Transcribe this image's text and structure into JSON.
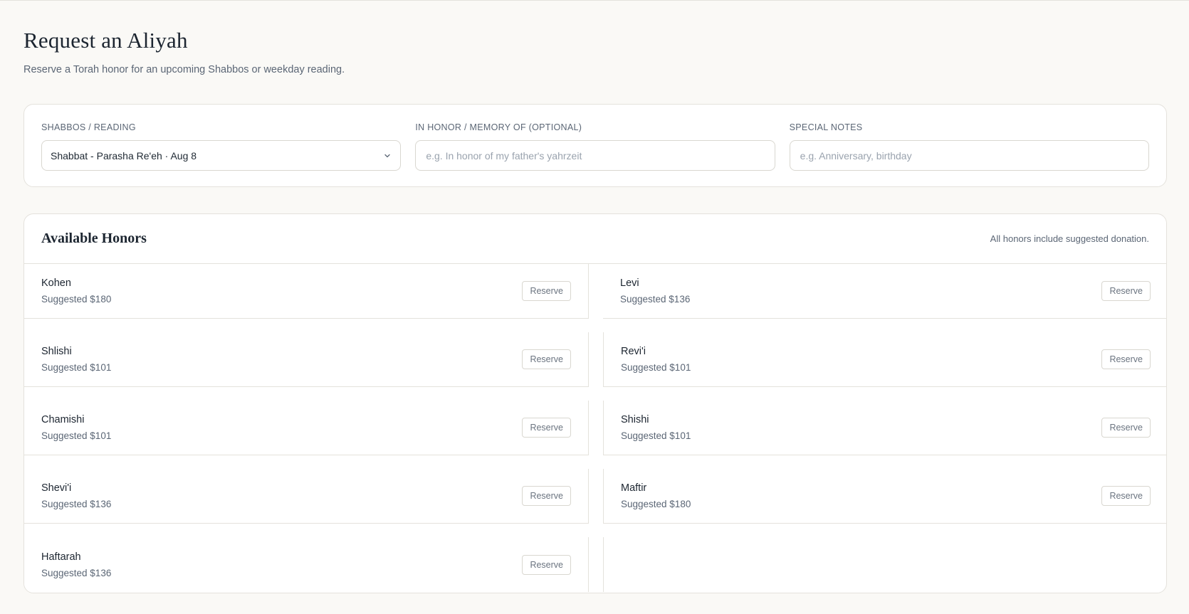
{
  "page": {
    "title": "Request an Aliyah",
    "subtitle": "Reserve a Torah honor for an upcoming Shabbos or weekday reading."
  },
  "form": {
    "reading_label": "SHABBOS / READING",
    "reading_value": "Shabbat - Parasha Re'eh · Aug 8",
    "honor_label": "IN HONOR / MEMORY OF (OPTIONAL)",
    "honor_placeholder": "e.g. In honor of my father's yahrzeit",
    "notes_label": "SPECIAL NOTES",
    "notes_placeholder": "e.g. Anniversary, birthday"
  },
  "honors": {
    "title": "Available Honors",
    "note": "All honors include suggested donation.",
    "reserve_label": "Reserve",
    "items": [
      {
        "name": "Kohen",
        "price": "Suggested $180"
      },
      {
        "name": "Levi",
        "price": "Suggested $136"
      },
      {
        "name": "Shlishi",
        "price": "Suggested $101"
      },
      {
        "name": "Revi'i",
        "price": "Suggested $101"
      },
      {
        "name": "Chamishi",
        "price": "Suggested $101"
      },
      {
        "name": "Shishi",
        "price": "Suggested $101"
      },
      {
        "name": "Shevi'i",
        "price": "Suggested $136"
      },
      {
        "name": "Maftir",
        "price": "Suggested $180"
      },
      {
        "name": "Haftarah",
        "price": "Suggested $136"
      }
    ]
  },
  "icons": {
    "select_chevron": "chevron-down-icon"
  },
  "colors": {
    "background": "#faf9f6",
    "card": "#ffffff",
    "border": "#e4e2dc",
    "text": "#1c2530",
    "muted": "#5b6675"
  }
}
